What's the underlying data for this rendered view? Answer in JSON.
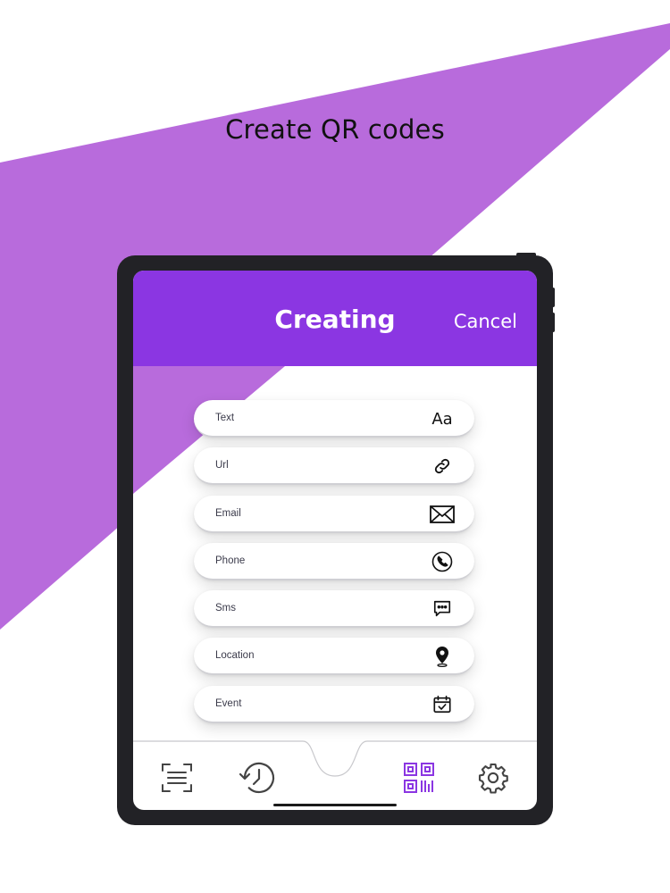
{
  "page": {
    "headline": "Create QR codes",
    "accent_color": "#8b36e2",
    "background_shape_color": "#b86bdc"
  },
  "header": {
    "title": "Creating",
    "cancel_label": "Cancel"
  },
  "menu": {
    "items": [
      {
        "label": "Text",
        "icon": "text-aa-icon",
        "icon_text": "Aa"
      },
      {
        "label": "Url",
        "icon": "link-icon"
      },
      {
        "label": "Email",
        "icon": "envelope-icon"
      },
      {
        "label": "Phone",
        "icon": "phone-icon"
      },
      {
        "label": "Sms",
        "icon": "chat-bubble-icon"
      },
      {
        "label": "Location",
        "icon": "map-pin-icon"
      },
      {
        "label": "Event",
        "icon": "calendar-icon"
      }
    ]
  },
  "tabbar": {
    "tabs": [
      {
        "name": "scan",
        "icon": "scan-icon",
        "active": false
      },
      {
        "name": "history",
        "icon": "history-icon",
        "active": false
      },
      {
        "name": "create",
        "icon": "qr-code-icon",
        "active": true
      },
      {
        "name": "settings",
        "icon": "gear-icon",
        "active": false
      }
    ]
  }
}
